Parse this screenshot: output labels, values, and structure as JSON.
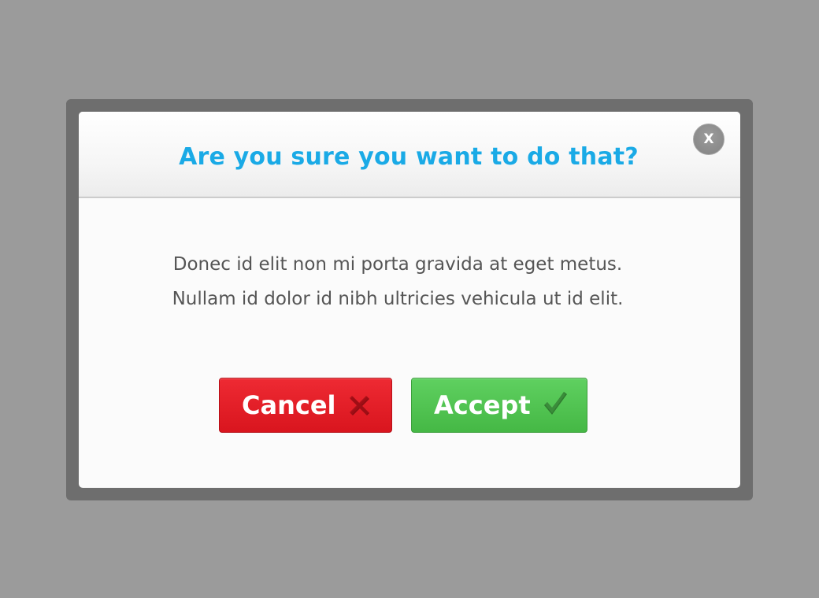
{
  "dialog": {
    "title": "Are you sure you want to do that?",
    "close_label": "X",
    "message_lines": [
      "Donec id elit non mi porta gravida at eget metus.",
      "Nullam id dolor id nibh ultricies vehicula ut id elit."
    ],
    "buttons": {
      "cancel": {
        "label": "Cancel",
        "icon": "cross-icon",
        "color": "#e31b23"
      },
      "accept": {
        "label": "Accept",
        "icon": "checkmark-icon",
        "color": "#52c452"
      }
    }
  },
  "colors": {
    "backdrop": "#9b9b9b",
    "frame": "#6e6e6e",
    "title": "#1aaae6",
    "body_text": "#555555"
  }
}
